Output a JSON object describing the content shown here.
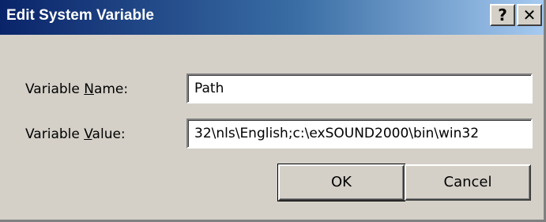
{
  "window": {
    "title": "Edit System Variable",
    "help_glyph": "?",
    "close_glyph": "✕"
  },
  "form": {
    "name_label_pre": "Variable ",
    "name_label_key": "N",
    "name_label_post": "ame:",
    "name_value": "Path",
    "value_label_pre": "Variable ",
    "value_label_key": "V",
    "value_label_post": "alue:",
    "value_value": "32\\nls\\English;c:\\exSOUND2000\\bin\\win32"
  },
  "buttons": {
    "ok_label": "OK",
    "cancel_label": "Cancel"
  },
  "colors": {
    "face": "#d4d0c8",
    "title_start": "#0a246a",
    "title_end": "#a6caf0"
  }
}
